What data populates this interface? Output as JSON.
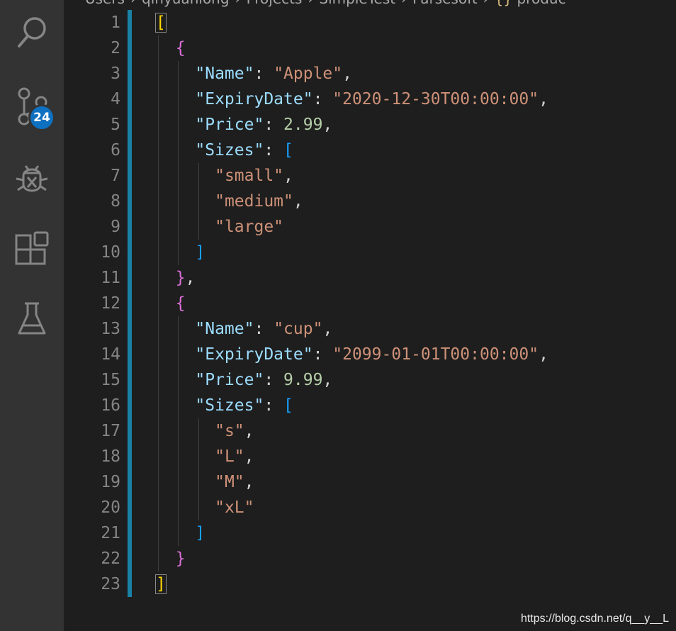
{
  "breadcrumb": {
    "items": [
      "Users",
      "qinyuanlong",
      "Projects",
      "SimpleTest",
      "Parsesoft"
    ],
    "file_icon": "{}",
    "file": "produc"
  },
  "activity_bar": {
    "icons": [
      "search-icon",
      "source-control-icon",
      "debug-icon",
      "extensions-icon",
      "testing-icon"
    ],
    "source_control_badge": "24",
    "badge_color": "#0e70c0"
  },
  "editor": {
    "line_numbers": [
      "1",
      "2",
      "3",
      "4",
      "5",
      "6",
      "7",
      "8",
      "9",
      "10",
      "11",
      "12",
      "13",
      "14",
      "15",
      "16",
      "17",
      "18",
      "19",
      "20",
      "21",
      "22",
      "23"
    ],
    "lines": [
      [
        {
          "t": "[",
          "c": "br1 match"
        }
      ],
      [
        {
          "t": "  "
        },
        {
          "t": "{",
          "c": "br2"
        }
      ],
      [
        {
          "t": "    "
        },
        {
          "t": "\"Name\"",
          "c": "key"
        },
        {
          "t": ": ",
          "c": "punc"
        },
        {
          "t": "\"Apple\"",
          "c": "str"
        },
        {
          "t": ",",
          "c": "punc"
        }
      ],
      [
        {
          "t": "    "
        },
        {
          "t": "\"ExpiryDate\"",
          "c": "key"
        },
        {
          "t": ": ",
          "c": "punc"
        },
        {
          "t": "\"2020-12-30T00:00:00\"",
          "c": "str"
        },
        {
          "t": ",",
          "c": "punc"
        }
      ],
      [
        {
          "t": "    "
        },
        {
          "t": "\"Price\"",
          "c": "key"
        },
        {
          "t": ": ",
          "c": "punc"
        },
        {
          "t": "2.99",
          "c": "num"
        },
        {
          "t": ",",
          "c": "punc"
        }
      ],
      [
        {
          "t": "    "
        },
        {
          "t": "\"Sizes\"",
          "c": "key"
        },
        {
          "t": ": ",
          "c": "punc"
        },
        {
          "t": "[",
          "c": "br3"
        }
      ],
      [
        {
          "t": "      "
        },
        {
          "t": "\"small\"",
          "c": "str"
        },
        {
          "t": ",",
          "c": "punc"
        }
      ],
      [
        {
          "t": "      "
        },
        {
          "t": "\"medium\"",
          "c": "str"
        },
        {
          "t": ",",
          "c": "punc"
        }
      ],
      [
        {
          "t": "      "
        },
        {
          "t": "\"large\"",
          "c": "str"
        }
      ],
      [
        {
          "t": "    "
        },
        {
          "t": "]",
          "c": "br3"
        }
      ],
      [
        {
          "t": "  "
        },
        {
          "t": "}",
          "c": "br2"
        },
        {
          "t": ",",
          "c": "punc"
        }
      ],
      [
        {
          "t": "  "
        },
        {
          "t": "{",
          "c": "br2"
        }
      ],
      [
        {
          "t": "    "
        },
        {
          "t": "\"Name\"",
          "c": "key"
        },
        {
          "t": ": ",
          "c": "punc"
        },
        {
          "t": "\"cup\"",
          "c": "str"
        },
        {
          "t": ",",
          "c": "punc"
        }
      ],
      [
        {
          "t": "    "
        },
        {
          "t": "\"ExpiryDate\"",
          "c": "key"
        },
        {
          "t": ": ",
          "c": "punc"
        },
        {
          "t": "\"2099-01-01T00:00:00\"",
          "c": "str"
        },
        {
          "t": ",",
          "c": "punc"
        }
      ],
      [
        {
          "t": "    "
        },
        {
          "t": "\"Price\"",
          "c": "key"
        },
        {
          "t": ": ",
          "c": "punc"
        },
        {
          "t": "9.99",
          "c": "num"
        },
        {
          "t": ",",
          "c": "punc"
        }
      ],
      [
        {
          "t": "    "
        },
        {
          "t": "\"Sizes\"",
          "c": "key"
        },
        {
          "t": ": ",
          "c": "punc"
        },
        {
          "t": "[",
          "c": "br3"
        }
      ],
      [
        {
          "t": "      "
        },
        {
          "t": "\"s\"",
          "c": "str"
        },
        {
          "t": ",",
          "c": "punc"
        }
      ],
      [
        {
          "t": "      "
        },
        {
          "t": "\"L\"",
          "c": "str"
        },
        {
          "t": ",",
          "c": "punc"
        }
      ],
      [
        {
          "t": "      "
        },
        {
          "t": "\"M\"",
          "c": "str"
        },
        {
          "t": ",",
          "c": "punc"
        }
      ],
      [
        {
          "t": "      "
        },
        {
          "t": "\"xL\"",
          "c": "str"
        }
      ],
      [
        {
          "t": "    "
        },
        {
          "t": "]",
          "c": "br3"
        }
      ],
      [
        {
          "t": "  "
        },
        {
          "t": "}",
          "c": "br2"
        }
      ],
      [
        {
          "t": "]",
          "c": "br1 match"
        }
      ]
    ]
  },
  "watermark": "https://blog.csdn.net/q__y__L"
}
